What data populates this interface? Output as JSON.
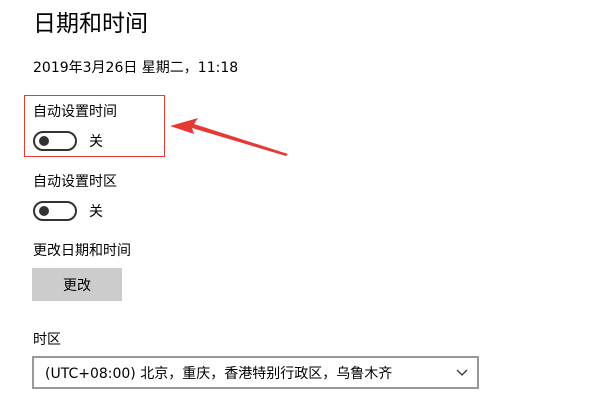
{
  "page": {
    "title": "日期和时间",
    "current_datetime": "2019年3月26日 星期二，11:18"
  },
  "auto_time": {
    "label": "自动设置时间",
    "state_text": "关",
    "state": "off"
  },
  "auto_timezone": {
    "label": "自动设置时区",
    "state_text": "关",
    "state": "off"
  },
  "change_datetime": {
    "label": "更改日期和时间",
    "button_label": "更改"
  },
  "timezone": {
    "label": "时区",
    "selected": "(UTC+08:00) 北京，重庆，香港特别行政区，乌鲁木齐"
  },
  "annotation": {
    "color": "#e53935",
    "icons": [
      "arrow-icon"
    ]
  }
}
